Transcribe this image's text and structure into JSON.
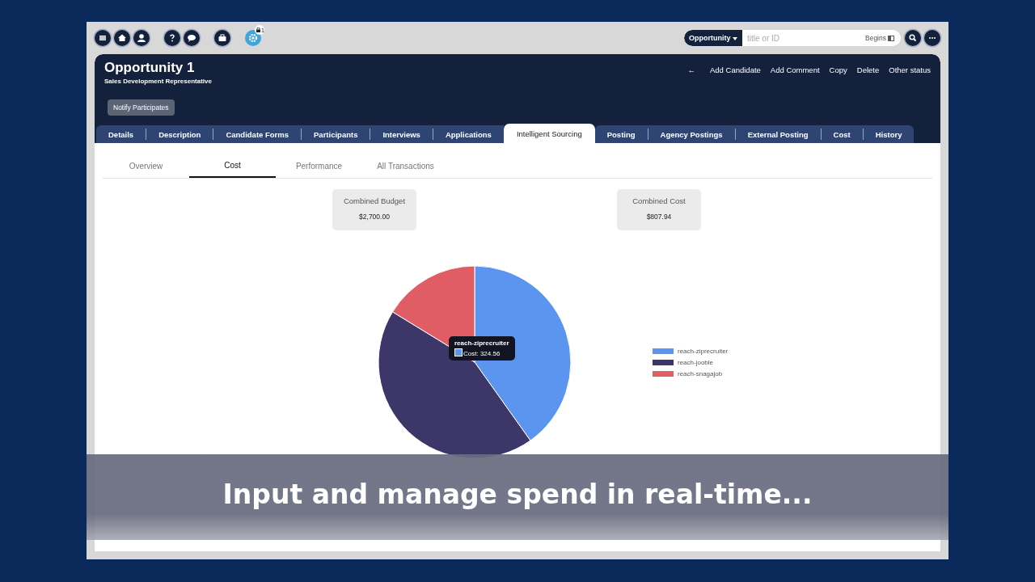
{
  "toolbar": {
    "badge": "1"
  },
  "search": {
    "scope": "Opportunity",
    "placeholder": "title or ID",
    "mode": "Begins"
  },
  "header": {
    "title": "Opportunity 1",
    "subtitle": "Sales Development Representative",
    "back": "←",
    "actions": [
      "Add Candidate",
      "Add Comment",
      "Copy",
      "Delete",
      "Other status"
    ],
    "button": "Notify Participates"
  },
  "tabs": [
    {
      "label": "Details",
      "selected": false
    },
    {
      "label": "Description",
      "selected": false
    },
    {
      "label": "Candidate Forms",
      "selected": false
    },
    {
      "label": "Participants",
      "selected": false
    },
    {
      "label": "Interviews",
      "selected": false
    },
    {
      "label": "Applications",
      "selected": false
    },
    {
      "label": "Intelligent Sourcing",
      "selected": true
    },
    {
      "label": "Posting",
      "selected": false
    },
    {
      "label": "Agency Postings",
      "selected": false
    },
    {
      "label": "External Posting",
      "selected": false
    },
    {
      "label": "Cost",
      "selected": false
    },
    {
      "label": "History",
      "selected": false
    }
  ],
  "subtabs": [
    {
      "label": "Overview",
      "selected": false
    },
    {
      "label": "Cost",
      "selected": true
    },
    {
      "label": "Performance",
      "selected": false
    },
    {
      "label": "All Transactions",
      "selected": false
    }
  ],
  "stats": [
    {
      "label": "Combined Budget",
      "value": "$2,700.00"
    },
    {
      "label": "Combined Cost",
      "value": "$807.94"
    }
  ],
  "chart_data": {
    "type": "pie",
    "categories": [
      "reach-ziprecruiter",
      "reach-jooble",
      "reach-snagajob"
    ],
    "legend": true,
    "series": [
      {
        "colors": [
          "#5b95ef",
          "#3d3769",
          "#e05d66"
        ],
        "values": [
          40.17,
          43.58,
          16.25
        ]
      }
    ]
  },
  "tooltip": {
    "title": "reach-ziprecruiter",
    "text": "Cost: 324.56",
    "color": "#5b95ef"
  },
  "caption": "Input and manage spend in real-time..."
}
